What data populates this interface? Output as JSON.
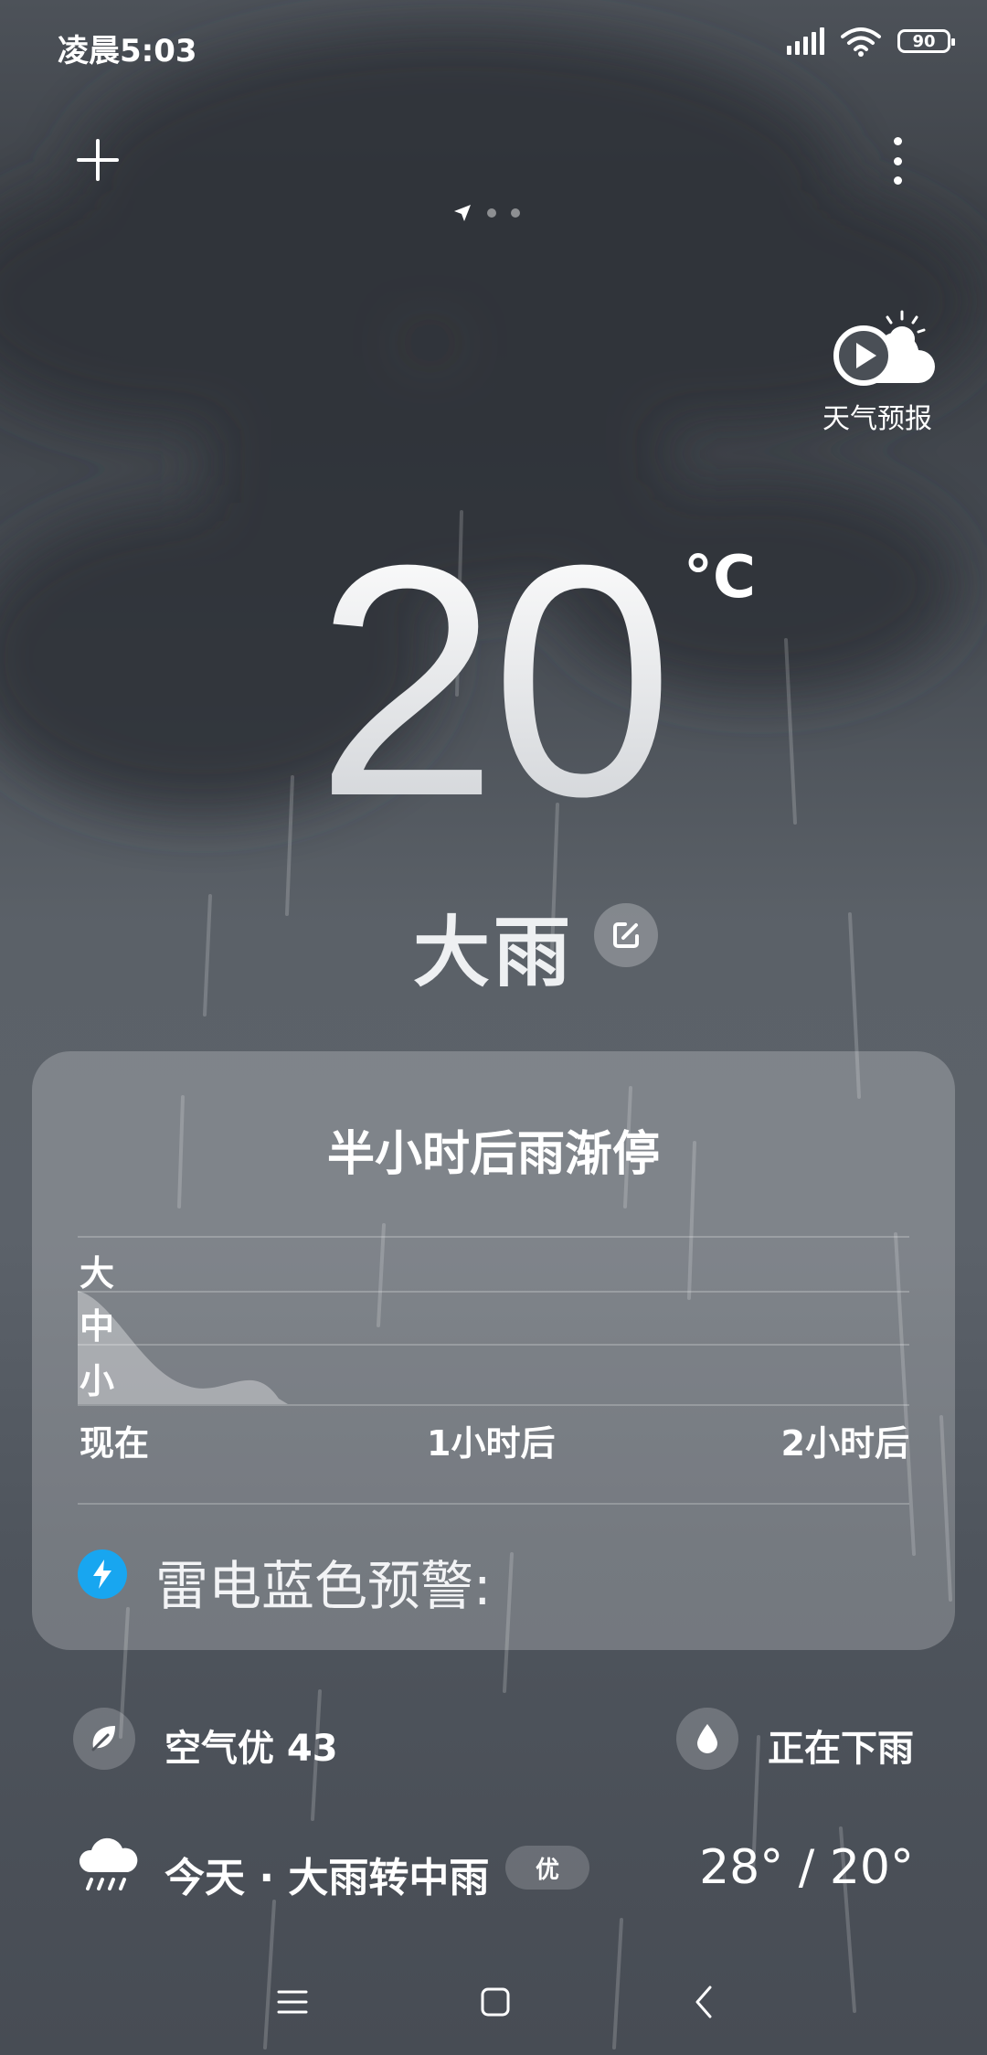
{
  "status": {
    "time": "凌晨5:03",
    "battery": "90"
  },
  "weather": {
    "temperature": "20",
    "unit": "°C",
    "condition": "大雨",
    "forecast_label": "天气预报"
  },
  "nowcast": {
    "title": "半小时后雨渐停",
    "levels": [
      "大",
      "中",
      "小"
    ],
    "time_labels": [
      "现在",
      "1小时后",
      "2小时后"
    ],
    "alert": "雷电蓝色预警:"
  },
  "info": {
    "air_quality": "空气优 43",
    "precip_status": "正在下雨"
  },
  "today": {
    "label": "今天 · 大雨转中雨",
    "aqi_badge": "优",
    "temps": "28° / 20°"
  },
  "colors": {
    "alert_blue": "#18a6f0",
    "card_bg": "rgba(255,255,255,0.22)"
  }
}
